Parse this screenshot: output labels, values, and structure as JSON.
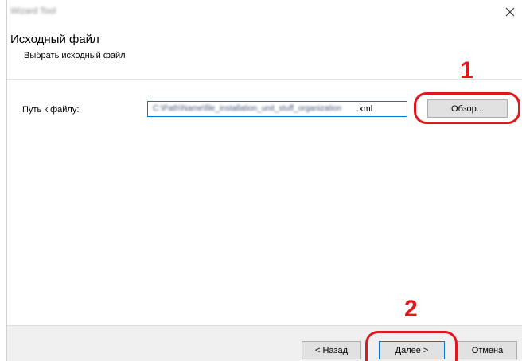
{
  "window": {
    "title": "Wizard Tool",
    "close_glyph": "✕"
  },
  "header": {
    "title": "Исходный файл",
    "subtitle": "Выбрать исходный файл"
  },
  "form": {
    "path_label": "Путь к файлу:",
    "path_value_hidden": "C:\\Path\\Name\\file_installation_unit_stuff_organization",
    "path_value_ext": ".xml",
    "browse_label": "Обзор..."
  },
  "footer": {
    "back_label": "< Назад",
    "next_label": "Далее >",
    "cancel_label": "Отмена"
  },
  "callouts": {
    "step1": "1",
    "step2": "2",
    "color": "#e0181e"
  },
  "colors": {
    "focus_border": "#0078d7",
    "button_bg": "#e1e1e1",
    "footer_bg": "#f0f0f0"
  }
}
